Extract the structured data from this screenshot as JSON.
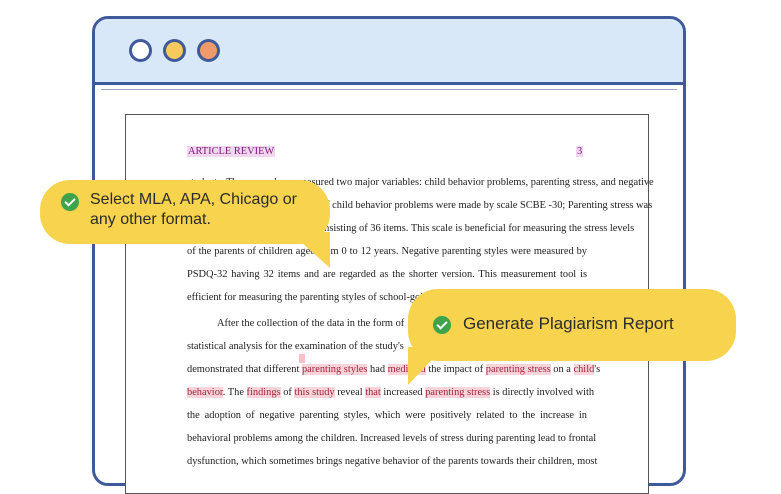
{
  "document": {
    "header_title": "ARTICLE REVIEW",
    "page_number": "3",
    "lines": [
      "students. The researchers measured two major variables: child behavior problems, parenting stress, and negative",
      "parenting styles. Measurements of child behavior problems were made by scale SCBE -30; Parenting stress was",
      "measured by PSI-SF, which is consisting of 36 items. This scale is beneficial for measuring the stress levels",
      "of the parents of children aged from 0 to 12 years. Negative parenting styles were measured by",
      "PSDQ-32 having 32 items and are regarded as the shorter version.  This measurement tool is",
      "efficient for measuring the parenting styles of school-going children."
    ],
    "para2_line1": "After the collection of the data in the form of",
    "para2_line2": "statistical analysis for the examination of the study's",
    "hl_line3": {
      "a": "demonstrated that different ",
      "b": "parenting styles",
      "c": " had ",
      "d": "mediated",
      "e": " the impact of ",
      "f": "parenting stress",
      "g": " on a ",
      "h": "child",
      "i": "'s"
    },
    "hl_line4": {
      "a": "behavior",
      "b": ". The ",
      "c": "findings",
      "d": " of ",
      "e": "this study",
      "f": " reveal ",
      "g": "that",
      "h": " increased ",
      "i": "parenting stress",
      "j": " is directly involved with"
    },
    "tail_lines": [
      "the adoption of negative parenting styles, which were positively related to the increase in",
      "behavioral problems among the children. Increased levels of stress during parenting lead to frontal",
      "dysfunction, which sometimes brings negative behavior of the parents towards their children, most"
    ]
  },
  "callouts": {
    "format": "Select MLA, APA, Chicago or any other format.",
    "report": "Generate Plagiarism Report"
  },
  "colors": {
    "window_border": "#3f5a9a",
    "titlebar": "#d9e8f8",
    "bubble": "#f7d34e",
    "check": "#3ea34a",
    "highlight": "#f8d4da"
  },
  "icons": [
    "window-dot-close",
    "window-dot-minimize",
    "window-dot-maximize",
    "check-circle-icon"
  ]
}
